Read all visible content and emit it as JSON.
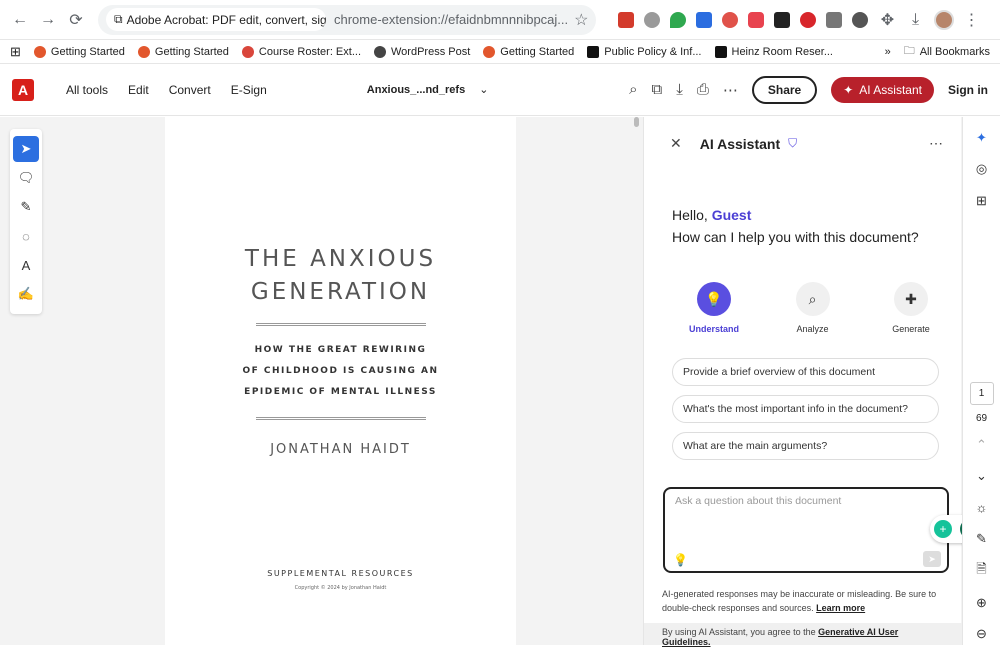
{
  "browser": {
    "tab_title": "Adobe Acrobat: PDF edit, convert, sign too",
    "url": "chrome-extension://efaidnbmnnnibpcaj...",
    "bookmarks": [
      {
        "label": "Getting Started",
        "icon": "firefox-icon"
      },
      {
        "label": "Getting Started",
        "icon": "firefox-icon"
      },
      {
        "label": "Course Roster: Ext...",
        "icon": "roster-icon"
      },
      {
        "label": "WordPress Post",
        "icon": "globe-icon"
      },
      {
        "label": "Getting Started",
        "icon": "firefox-icon"
      },
      {
        "label": "Public Policy & Inf...",
        "icon": "heinz-icon"
      },
      {
        "label": "Heinz Room Reser...",
        "icon": "heinz-icon"
      }
    ],
    "more_bookmarks": "»",
    "all_bookmarks": "All Bookmarks"
  },
  "acrobat": {
    "menu": [
      "All tools",
      "Edit",
      "Convert",
      "E-Sign"
    ],
    "filename": "Anxious_...nd_refs",
    "share": "Share",
    "ai_button": "AI Assistant",
    "sign_in": "Sign in"
  },
  "pdf": {
    "title_line1": "THE ANXIOUS",
    "title_line2": "GENERATION",
    "subtitle_line1": "HOW THE GREAT REWIRING",
    "subtitle_line2": "OF CHILDHOOD IS CAUSING AN",
    "subtitle_line3": "EPIDEMIC OF MENTAL ILLNESS",
    "author": "JONATHAN HAIDT",
    "supplemental": "SUPPLEMENTAL RESOURCES",
    "copyright": "Copyright © 2024 by Jonathan Haidt"
  },
  "ai_panel": {
    "title": "AI Assistant",
    "greeting": "Hello, ",
    "user": "Guest",
    "question": "How can I help you with this document?",
    "modes": [
      "Understand",
      "Analyze",
      "Generate"
    ],
    "suggestions": [
      "Provide a brief overview of this document",
      "What's the most important info in the document?",
      "What are the main arguments?"
    ],
    "input_placeholder": "Ask a question about this document",
    "disclaimer": "AI-generated responses may be inaccurate or misleading. Be sure to double-check responses and sources.",
    "learn_more": "Learn more",
    "terms_prefix": "By using AI Assistant, you agree to the ",
    "terms_link": "Generative AI User Guidelines."
  },
  "rail": {
    "page_current": "1",
    "page_total": "69"
  },
  "colors": {
    "accent": "#2c6fe0",
    "ai_red": "#b8212b",
    "purple": "#5a4fe0"
  }
}
